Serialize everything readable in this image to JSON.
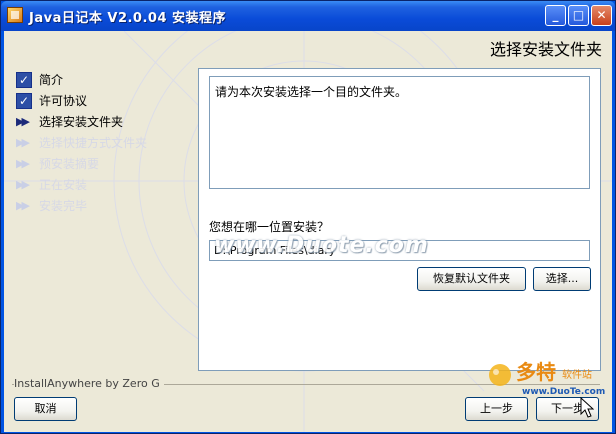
{
  "window": {
    "title": "Java日记本 V2.0.04 安装程序",
    "controls": {
      "minimize": "_",
      "maximize": "□",
      "close": "✕"
    }
  },
  "header": {
    "step_title": "选择安装文件夹"
  },
  "steps": [
    {
      "label": "简介",
      "state": "done",
      "icon": "check-icon"
    },
    {
      "label": "许可协议",
      "state": "done",
      "icon": "check-icon"
    },
    {
      "label": "选择安装文件夹",
      "state": "active",
      "icon": "double-arrow-icon"
    },
    {
      "label": "选择快捷方式文件夹",
      "state": "pending",
      "icon": "double-arrow-icon"
    },
    {
      "label": "预安装摘要",
      "state": "pending",
      "icon": "double-arrow-icon"
    },
    {
      "label": "正在安装",
      "state": "pending",
      "icon": "double-arrow-icon"
    },
    {
      "label": "安装完毕",
      "state": "pending",
      "icon": "double-arrow-icon"
    }
  ],
  "content": {
    "instruction": "请为本次安装选择一个目的文件夹。",
    "question": "您想在哪一位置安装？",
    "install_path": "D:\\Program Files\\diary",
    "restore_default_label": "恢复默认文件夹",
    "choose_label": "选择..."
  },
  "footer": {
    "brand": "InstallAnywhere by Zero G",
    "cancel_label": "取消",
    "previous_label": "上一步",
    "next_label": "下一步"
  },
  "watermark": {
    "text": "www.Duote.com"
  },
  "logo": {
    "main": "多特",
    "sub": "软件站",
    "url": "www.DuoTe.com"
  },
  "colors": {
    "title_bar": "#0a4bd8",
    "panel": "#ece9d8",
    "accent": "#2d4fa6"
  }
}
